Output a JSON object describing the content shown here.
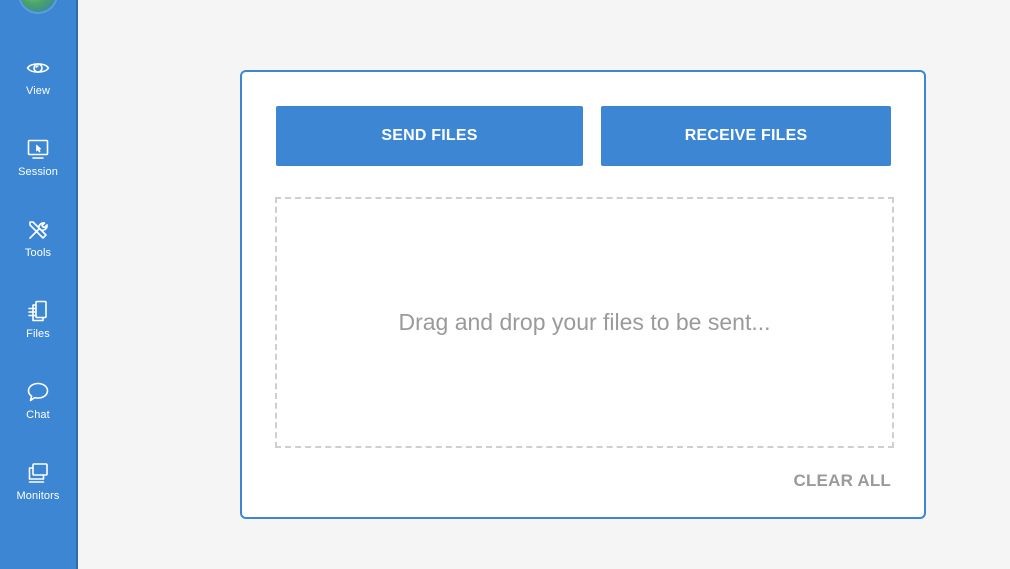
{
  "sidebar": {
    "items": [
      {
        "label": "View",
        "icon": "eye-icon"
      },
      {
        "label": "Session",
        "icon": "monitor-cursor-icon"
      },
      {
        "label": "Tools",
        "icon": "tools-icon"
      },
      {
        "label": "Files",
        "icon": "files-icon"
      },
      {
        "label": "Chat",
        "icon": "chat-bubble-icon"
      },
      {
        "label": "Monitors",
        "icon": "monitors-icon"
      }
    ],
    "background_color": "#3d86d4"
  },
  "file_transfer": {
    "send_label": "SEND FILES",
    "receive_label": "RECEIVE FILES",
    "dropzone_text": "Drag and drop your files to be sent...",
    "clear_label": "CLEAR ALL",
    "accent_color": "#3d86d4"
  }
}
